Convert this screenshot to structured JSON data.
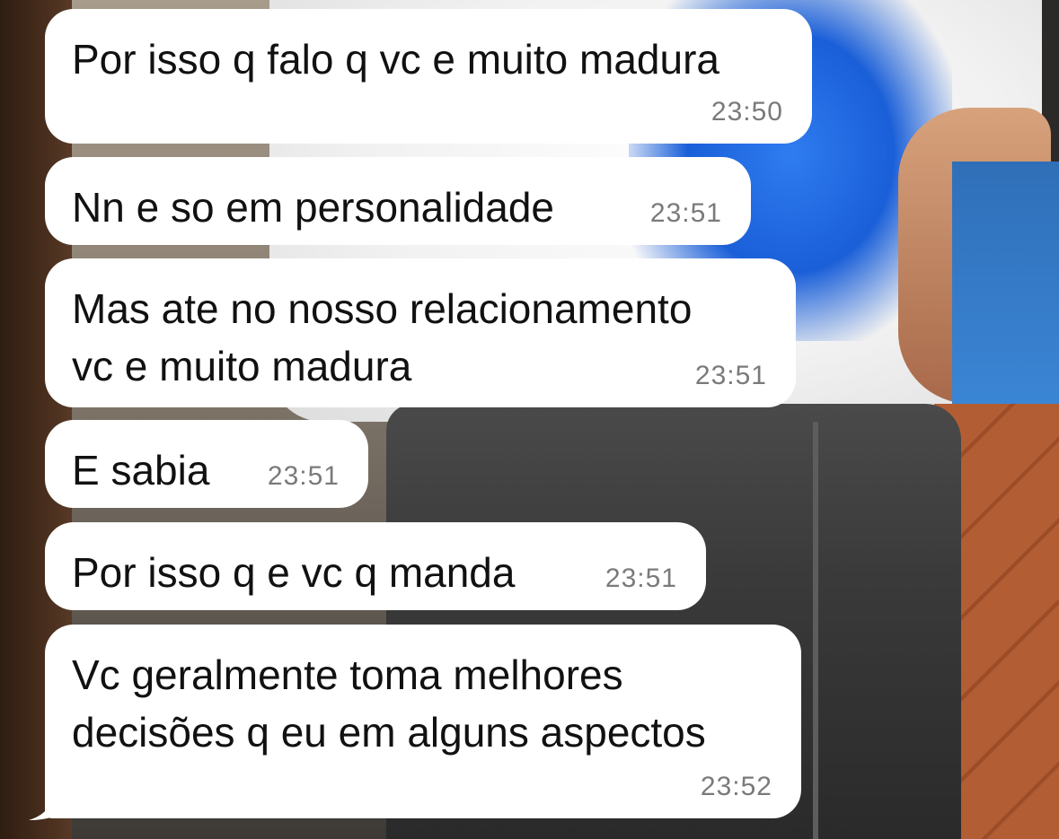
{
  "messages": [
    {
      "text": "Por isso q falo q vc e muito madura",
      "time": "23:50"
    },
    {
      "text": "Nn e so em personalidade",
      "time": "23:51"
    },
    {
      "text": "Mas ate no nosso relacionamento\nvc e muito madura",
      "time": "23:51"
    },
    {
      "text": "E sabia",
      "time": "23:51"
    },
    {
      "text": "Por isso q e vc q manda",
      "time": "23:51"
    },
    {
      "text": "Vc geralmente toma melhores\ndecisões q eu em alguns aspectos",
      "time": "23:52"
    }
  ],
  "colors": {
    "bubble_bg": "#ffffff",
    "text": "#111111",
    "timestamp": "#7a7a7a"
  }
}
